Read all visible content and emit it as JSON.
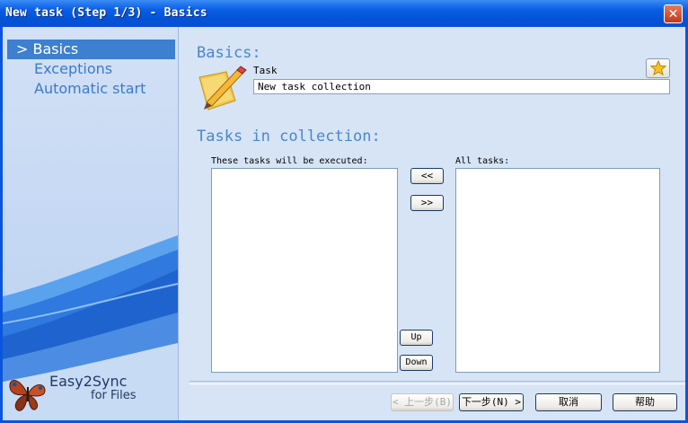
{
  "window": {
    "title": "New task (Step 1/3) - Basics",
    "close_glyph": "✕"
  },
  "sidebar": {
    "items": [
      {
        "label": "> Basics",
        "active": true
      },
      {
        "label": "Exceptions",
        "active": false
      },
      {
        "label": "Automatic start",
        "active": false
      }
    ],
    "brand_line1": "Easy2Sync",
    "brand_line2": "for Files"
  },
  "basics": {
    "heading": "Basics:",
    "task_label": "Task",
    "task_value": "New task collection",
    "favorite_icon": "star-icon",
    "pencil_icon": "pencil-icon"
  },
  "collection": {
    "heading": "Tasks in collection:",
    "executed_label": "These tasks will be executed:",
    "all_label": "All tasks:",
    "move_left": "<<",
    "move_right": ">>",
    "up": "Up",
    "down": "Down",
    "executed_items": [],
    "all_items": []
  },
  "footer": {
    "prev": "< 上一步(B)",
    "next": "下一步(N) >",
    "cancel": "取消",
    "help": "帮助"
  },
  "colors": {
    "title_bar": "#0a55dd",
    "accent_text": "#4a87c8",
    "selected_item": "#3d7fd0",
    "panel": "#d6e4f6"
  }
}
